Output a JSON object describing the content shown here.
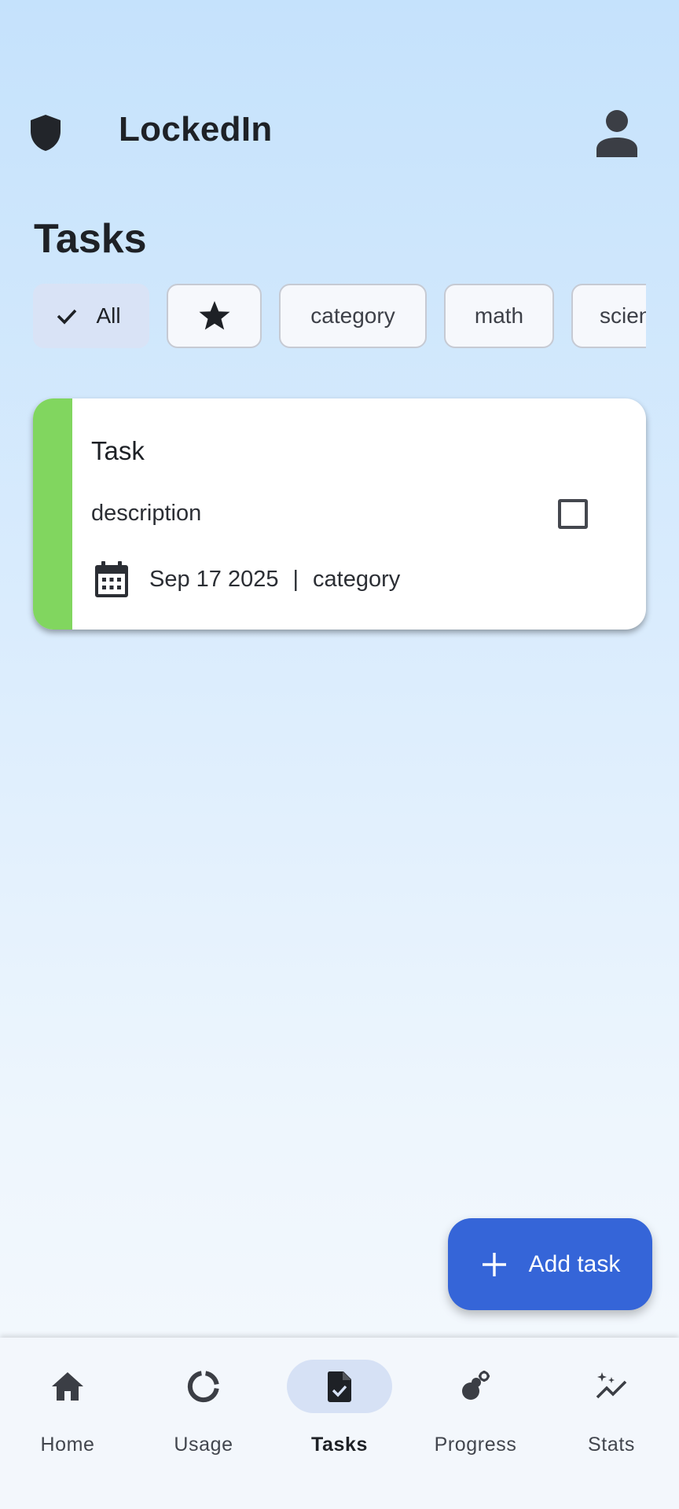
{
  "app": {
    "title": "LockedIn"
  },
  "page": {
    "title": "Tasks"
  },
  "filters": {
    "chips": [
      {
        "label": "All",
        "selected": true
      },
      {
        "label": "",
        "icon": "star-icon",
        "selected": false
      },
      {
        "label": "category",
        "selected": false
      },
      {
        "label": "math",
        "selected": false
      },
      {
        "label": "science",
        "selected": false
      }
    ]
  },
  "task": {
    "title": "Task",
    "description": "description",
    "date": "Sep 17 2025",
    "separator": "|",
    "category": "category",
    "completed": false,
    "accent_color": "#81d65f"
  },
  "fab": {
    "label": "Add task"
  },
  "nav": {
    "items": [
      {
        "label": "Home",
        "icon": "home-icon",
        "active": false
      },
      {
        "label": "Usage",
        "icon": "donut-icon",
        "active": false
      },
      {
        "label": "Tasks",
        "icon": "task-file-icon",
        "active": true
      },
      {
        "label": "Progress",
        "icon": "progress-icon",
        "active": false
      },
      {
        "label": "Stats",
        "icon": "stats-icon",
        "active": false
      }
    ]
  },
  "colors": {
    "primary": "#3565d8",
    "selected_chip": "#d9e3f6",
    "nav_active": "#d6e1f5",
    "background_top": "#c5e2fc"
  }
}
